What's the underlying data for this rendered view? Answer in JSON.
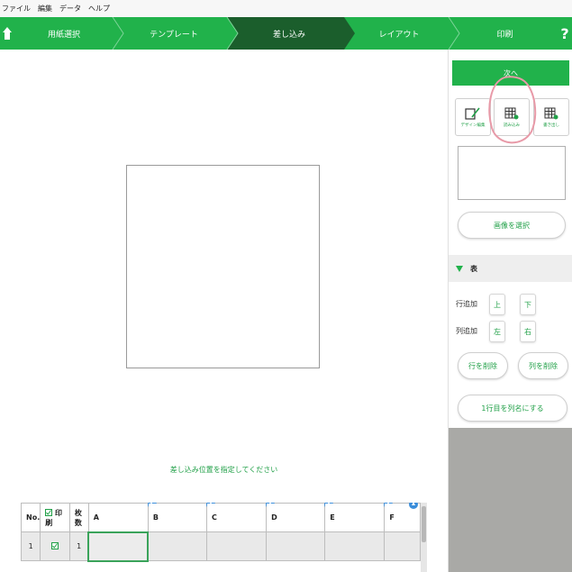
{
  "menu": [
    "ファイル",
    "編集",
    "データ",
    "ヘルプ"
  ],
  "steps": [
    {
      "label": "用紙選択",
      "active": false
    },
    {
      "label": "テンプレート",
      "active": false
    },
    {
      "label": "差し込み",
      "active": true
    },
    {
      "label": "レイアウト",
      "active": false
    },
    {
      "label": "印刷",
      "active": false
    }
  ],
  "help_label": "?",
  "instruction": "差し込み位置を指定してください",
  "grid": {
    "headers": [
      "No.",
      "印刷",
      "枚数",
      "A",
      "B",
      "C",
      "D",
      "E",
      "F"
    ],
    "row": {
      "no": "1",
      "count": "1"
    }
  },
  "side": {
    "next_button": "次へ",
    "tools": [
      {
        "label": "デザイン編集",
        "icon": "design-edit-icon"
      },
      {
        "label": "読み込み",
        "icon": "import-table-icon"
      },
      {
        "label": "書き出し",
        "icon": "export-table-icon"
      }
    ],
    "select_image_button": "画像を選択",
    "section_title": "表",
    "row_add_label": "行追加",
    "col_add_label": "列追加",
    "up": "上",
    "down": "下",
    "left": "左",
    "right": "右",
    "delete_row_button": "行を削除",
    "delete_col_button": "列を削除",
    "first_row_button": "1行目を列名にする"
  },
  "colors": {
    "brand_green": "#21b24b",
    "active_step": "#1b5e2c",
    "accent_blue": "#3b8edb"
  }
}
